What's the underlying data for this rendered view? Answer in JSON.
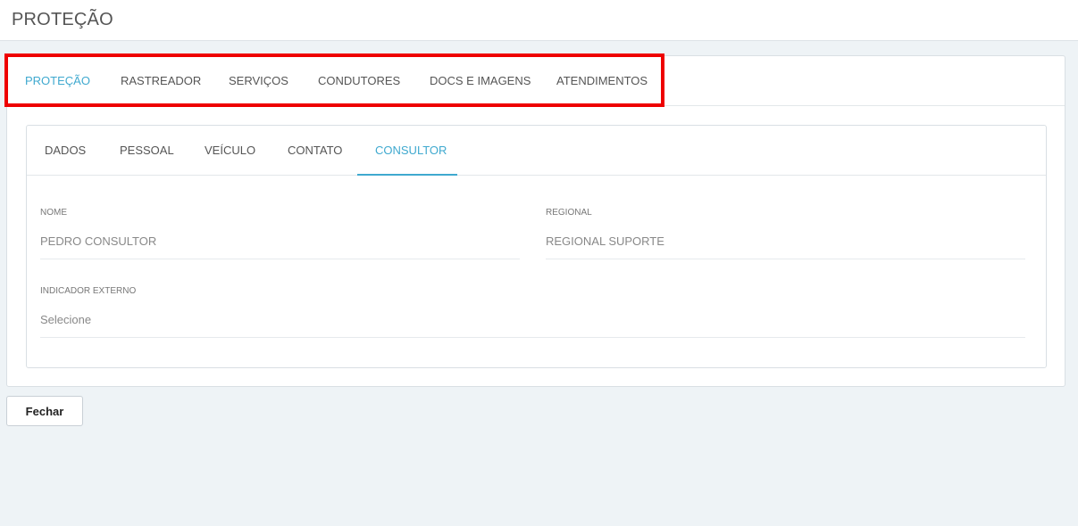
{
  "header": {
    "title": "PROTEÇÃO"
  },
  "outer_tabs": [
    {
      "label": "PROTEÇÃO",
      "active": true
    },
    {
      "label": "RASTREADOR",
      "active": false
    },
    {
      "label": "SERVIÇOS",
      "active": false
    },
    {
      "label": "CONDUTORES",
      "active": false
    },
    {
      "label": "DOCS E IMAGENS",
      "active": false
    },
    {
      "label": "ATENDIMENTOS",
      "active": false
    }
  ],
  "inner_tabs": [
    {
      "label": "DADOS",
      "active": false
    },
    {
      "label": "PESSOAL",
      "active": false
    },
    {
      "label": "VEÍCULO",
      "active": false
    },
    {
      "label": "CONTATO",
      "active": false
    },
    {
      "label": "CONSULTOR",
      "active": true
    }
  ],
  "form": {
    "nome": {
      "label": "NOME",
      "value": "PEDRO CONSULTOR"
    },
    "regional": {
      "label": "REGIONAL",
      "value": "REGIONAL SUPORTE"
    },
    "indicador_externo": {
      "label": "INDICADOR EXTERNO",
      "placeholder": "Selecione"
    }
  },
  "footer": {
    "close_label": "Fechar"
  },
  "colors": {
    "accent": "#3fa9cf",
    "highlight": "#ee0000",
    "background": "#eef3f6"
  }
}
